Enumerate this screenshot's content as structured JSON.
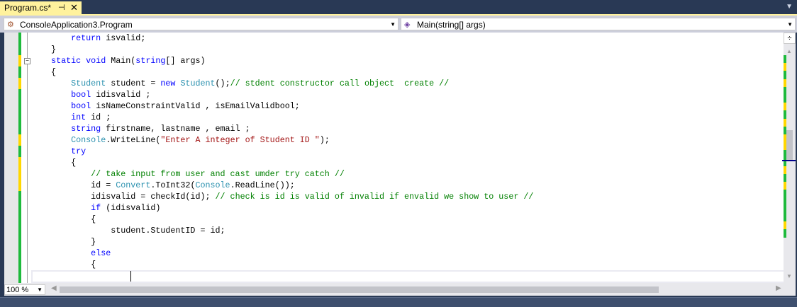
{
  "tab": {
    "title": "Program.cs*",
    "pin": "⊣",
    "close": "✕"
  },
  "nav": {
    "type_combo": "ConsoleApplication3.Program",
    "member_combo": "Main(string[] args)"
  },
  "zoom": "100 %",
  "colors": {
    "changed_saved": "#1eba3c",
    "changed_unsaved": "#ffd700",
    "keyword": "#0000ff",
    "type": "#2b91af",
    "comment": "#008000",
    "string": "#a31515"
  },
  "code": [
    [
      [
        "        return ",
        "kw"
      ],
      [
        "isvalid;",
        "pl"
      ]
    ],
    [
      [
        "    }",
        "pl"
      ]
    ],
    [
      [
        "    static void ",
        "kw"
      ],
      [
        "Main(",
        "pl"
      ],
      [
        "string",
        "kw"
      ],
      [
        "[] args)",
        "pl"
      ]
    ],
    [
      [
        "    {",
        "pl"
      ]
    ],
    [
      [
        "        ",
        "pl"
      ],
      [
        "Student",
        "ty"
      ],
      [
        " student = ",
        "pl"
      ],
      [
        "new ",
        "kw"
      ],
      [
        "Student",
        "ty"
      ],
      [
        "();",
        "pl"
      ],
      [
        "// stdent constructor call object  create //",
        "cm"
      ]
    ],
    [
      [
        "        bool ",
        "kw"
      ],
      [
        "idisvalid ;",
        "pl"
      ]
    ],
    [
      [
        "        bool ",
        "kw"
      ],
      [
        "isNameConstraintValid , isEmailValidbool;",
        "pl"
      ]
    ],
    [
      [
        "        int ",
        "kw"
      ],
      [
        "id ;",
        "pl"
      ]
    ],
    [
      [
        "        string ",
        "kw"
      ],
      [
        "firstname, lastname , email ;",
        "pl"
      ]
    ],
    [
      [
        "        ",
        "pl"
      ],
      [
        "Console",
        "ty"
      ],
      [
        ".WriteLine(",
        "pl"
      ],
      [
        "\"Enter A integer of Student ID \"",
        "st"
      ],
      [
        ");",
        "pl"
      ]
    ],
    [
      [
        "        try",
        "kw"
      ]
    ],
    [
      [
        "        {",
        "pl"
      ]
    ],
    [
      [
        "            // take input from user and cast umder try catch //",
        "cm"
      ]
    ],
    [
      [
        "            id = ",
        "pl"
      ],
      [
        "Convert",
        "ty"
      ],
      [
        ".ToInt32(",
        "pl"
      ],
      [
        "Console",
        "ty"
      ],
      [
        ".ReadLine());",
        "pl"
      ]
    ],
    [
      [
        "            idisvalid = checkId(id); ",
        "pl"
      ],
      [
        "// check is id is valid of invalid if envalid we show to user //",
        "cm"
      ]
    ],
    [
      [
        "            ",
        "pl"
      ],
      [
        "if ",
        "kw"
      ],
      [
        "(idisvalid)",
        "pl"
      ]
    ],
    [
      [
        "            {",
        "pl"
      ]
    ],
    [
      [
        "                student.StudentID = id;",
        "pl"
      ]
    ],
    [
      [
        "            }",
        "pl"
      ]
    ],
    [
      [
        "            else",
        "kw"
      ]
    ],
    [
      [
        "            {",
        "pl"
      ]
    ],
    [
      [
        "",
        "pl"
      ]
    ]
  ],
  "change_marks": [
    "g",
    "g",
    "y",
    "g",
    "y",
    "g",
    "g",
    "g",
    "g",
    "y",
    "g",
    "y",
    "y",
    "y",
    "g",
    "g",
    "g",
    "g",
    "g",
    "g",
    "g",
    "g"
  ]
}
